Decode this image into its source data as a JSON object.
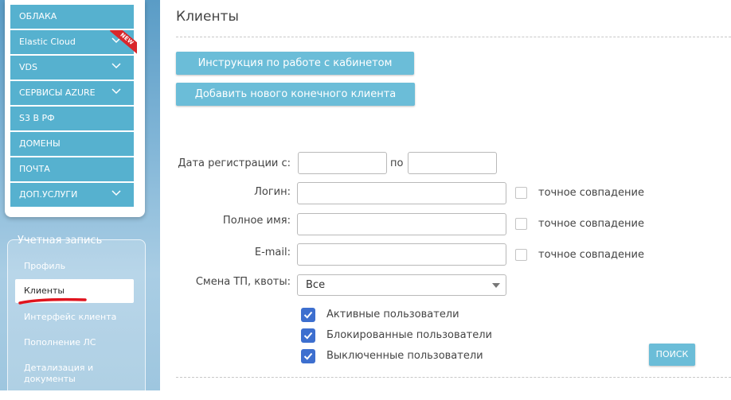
{
  "sidebar": {
    "menu": [
      {
        "label": "ОБЛАКА",
        "chevron": false
      },
      {
        "label": "Elastic Cloud",
        "chevron": true,
        "badge": "NEW"
      },
      {
        "label": "VDS",
        "chevron": true
      },
      {
        "label": "СЕРВИСЫ AZURE",
        "chevron": true
      },
      {
        "label": "S3 В РФ",
        "chevron": false
      },
      {
        "label": "ДОМЕНЫ",
        "chevron": false
      },
      {
        "label": "ПОЧТА",
        "chevron": false
      },
      {
        "label": "ДОП.УСЛУГИ",
        "chevron": true
      }
    ],
    "account": {
      "title": "Учетная запись",
      "items": [
        {
          "label": "Профиль"
        },
        {
          "label": "Клиенты",
          "active": true
        },
        {
          "label": "Интерфейс клиента"
        },
        {
          "label": "Пополнение ЛС"
        },
        {
          "label": "Детализация и документы"
        }
      ]
    }
  },
  "main": {
    "title": "Клиенты",
    "buttons": {
      "instructions": "Инструкция по работе с кабинетом",
      "add_client": "Добавить нового конечного клиента"
    },
    "filters": {
      "reg_date_label": "Дата регистрации с:",
      "reg_date_from": "",
      "to_label": "по",
      "reg_date_to": "",
      "login_label": "Логин:",
      "login_value": "",
      "fullname_label": "Полное имя:",
      "fullname_value": "",
      "email_label": "E-mail:",
      "email_value": "",
      "exact_match_label": "точное совпадение",
      "tariff_label": "Смена ТП, квоты:",
      "tariff_selected": "Все",
      "status_options": [
        {
          "label": "Активные пользователи",
          "checked": true
        },
        {
          "label": "Блокированные пользователи",
          "checked": true
        },
        {
          "label": "Выключенные пользователи",
          "checked": true
        }
      ],
      "search_button": "ПОИСК"
    }
  },
  "colors": {
    "menu_item_bg": "#56b1cf",
    "button_bg": "#6bbdd8",
    "checkbox_checked": "#3d6fcf",
    "badge_red": "#d9262b",
    "annotation_underline": "#e0141e"
  },
  "icons": [
    "chevron-down-icon",
    "calendar-icon",
    "checkmark-icon",
    "select-arrow-icon"
  ]
}
